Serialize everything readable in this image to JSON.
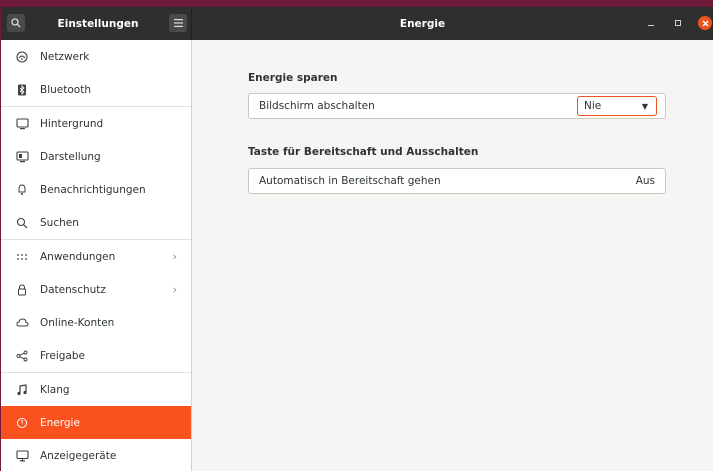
{
  "header": {
    "sidebar_title": "Einstellungen",
    "page_title": "Energie"
  },
  "sidebar": {
    "items": [
      {
        "label": "Netzwerk",
        "icon": "network-icon"
      },
      {
        "label": "Bluetooth",
        "icon": "bluetooth-icon"
      },
      {
        "label": "Hintergrund",
        "icon": "background-icon"
      },
      {
        "label": "Darstellung",
        "icon": "appearance-icon"
      },
      {
        "label": "Benachrichtigungen",
        "icon": "notifications-icon"
      },
      {
        "label": "Suchen",
        "icon": "search-icon"
      },
      {
        "label": "Anwendungen",
        "icon": "apps-icon"
      },
      {
        "label": "Datenschutz",
        "icon": "privacy-icon"
      },
      {
        "label": "Online-Konten",
        "icon": "cloud-icon"
      },
      {
        "label": "Freigabe",
        "icon": "share-icon"
      },
      {
        "label": "Klang",
        "icon": "music-note-icon"
      },
      {
        "label": "Energie",
        "icon": "power-icon"
      },
      {
        "label": "Anzeigegeräte",
        "icon": "display-icon"
      }
    ],
    "active_item": "Energie"
  },
  "main": {
    "power_saving": {
      "title": "Energie sparen",
      "screen_off_label": "Bildschirm abschalten",
      "screen_off_value": "Nie"
    },
    "suspend": {
      "title": "Taste für Bereitschaft und Ausschalten",
      "auto_suspend_label": "Automatisch in Bereitschaft gehen",
      "auto_suspend_value": "Aus"
    }
  },
  "colors": {
    "accent": "#f9521f",
    "headerbar": "#2f2f2f",
    "background": "#f6f5f4"
  }
}
